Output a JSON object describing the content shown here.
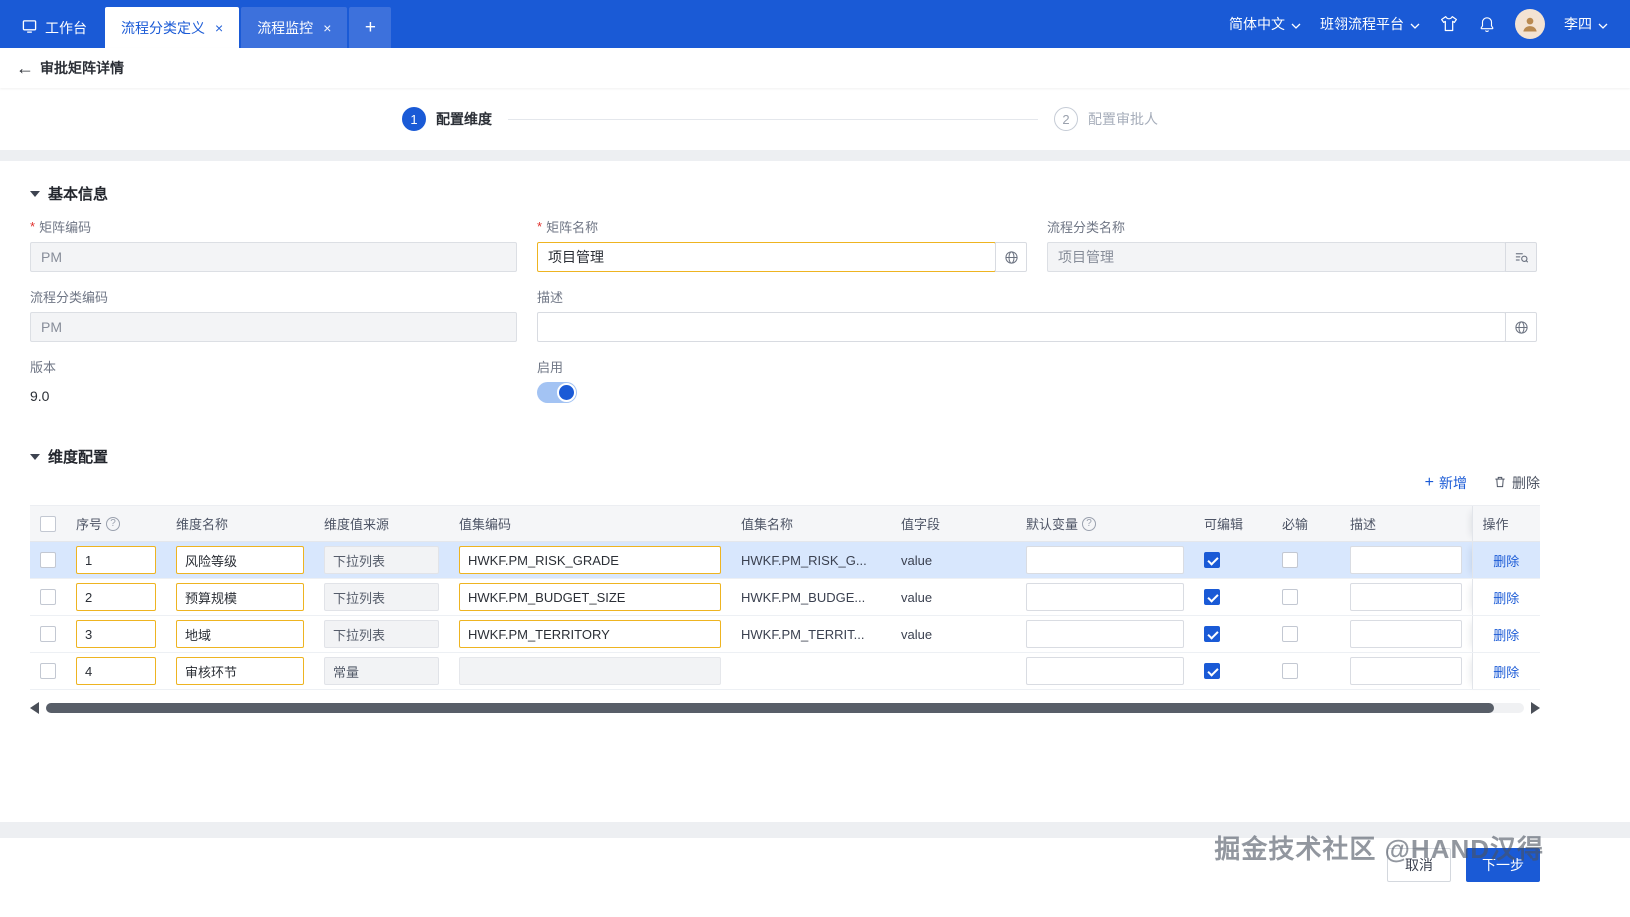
{
  "header": {
    "tabs": [
      {
        "label": "工作台"
      },
      {
        "label": "流程分类定义"
      },
      {
        "label": "流程监控"
      }
    ],
    "add_tab_label": "+",
    "close_icon": "×",
    "language": "简体中文",
    "platform": "班翎流程平台",
    "user": "李四"
  },
  "breadcrumb": {
    "back_icon": "←",
    "title": "审批矩阵详情"
  },
  "stepper": {
    "steps": [
      {
        "num": "1",
        "label": "配置维度"
      },
      {
        "num": "2",
        "label": "配置审批人"
      }
    ]
  },
  "basic_info": {
    "title": "基本信息",
    "matrix_code_label": "矩阵编码",
    "matrix_code_value": "PM",
    "matrix_name_label": "矩阵名称",
    "matrix_name_value": "项目管理",
    "category_name_label": "流程分类名称",
    "category_name_value": "项目管理",
    "category_code_label": "流程分类编码",
    "category_code_value": "PM",
    "description_label": "描述",
    "description_value": "",
    "version_label": "版本",
    "version_value": "9.0",
    "enabled_label": "启用",
    "enabled_on": true
  },
  "dimension": {
    "title": "维度配置",
    "add_label": "新增",
    "delete_label": "删除",
    "action_label": "删除",
    "columns": {
      "seq": "序号",
      "name": "维度名称",
      "source": "维度值来源",
      "code": "值集编码",
      "vsname": "值集名称",
      "vfield": "值字段",
      "defvar": "默认变量",
      "editable": "可编辑",
      "required": "必输",
      "desc": "描述",
      "action": "操作"
    },
    "rows": [
      {
        "seq": "1",
        "name": "风险等级",
        "source": "下拉列表",
        "code": "HWKF.PM_RISK_GRADE",
        "vsname": "HWKF.PM_RISK_G...",
        "vfield": "value",
        "defvar": "",
        "editable": true,
        "required": false,
        "desc": "",
        "selected": true,
        "code_disabled": false
      },
      {
        "seq": "2",
        "name": "预算规模",
        "source": "下拉列表",
        "code": "HWKF.PM_BUDGET_SIZE",
        "vsname": "HWKF.PM_BUDGE...",
        "vfield": "value",
        "defvar": "",
        "editable": true,
        "required": false,
        "desc": "",
        "selected": false,
        "code_disabled": false
      },
      {
        "seq": "3",
        "name": "地域",
        "source": "下拉列表",
        "code": "HWKF.PM_TERRITORY",
        "vsname": "HWKF.PM_TERRIT...",
        "vfield": "value",
        "defvar": "",
        "editable": true,
        "required": false,
        "desc": "",
        "selected": false,
        "code_disabled": false
      },
      {
        "seq": "4",
        "name": "审核环节",
        "source": "常量",
        "code": "",
        "vsname": "",
        "vfield": "",
        "defvar": "",
        "editable": true,
        "required": false,
        "desc": "",
        "selected": false,
        "code_disabled": true
      }
    ]
  },
  "footer": {
    "watermark": "掘金技术社区 @HAND汉得",
    "cancel_label": "取消",
    "next_label": "下一步"
  },
  "colors": {
    "primary": "#1a5ad6",
    "edited_border": "#eeb421",
    "selected_row": "#d8e7fd"
  }
}
